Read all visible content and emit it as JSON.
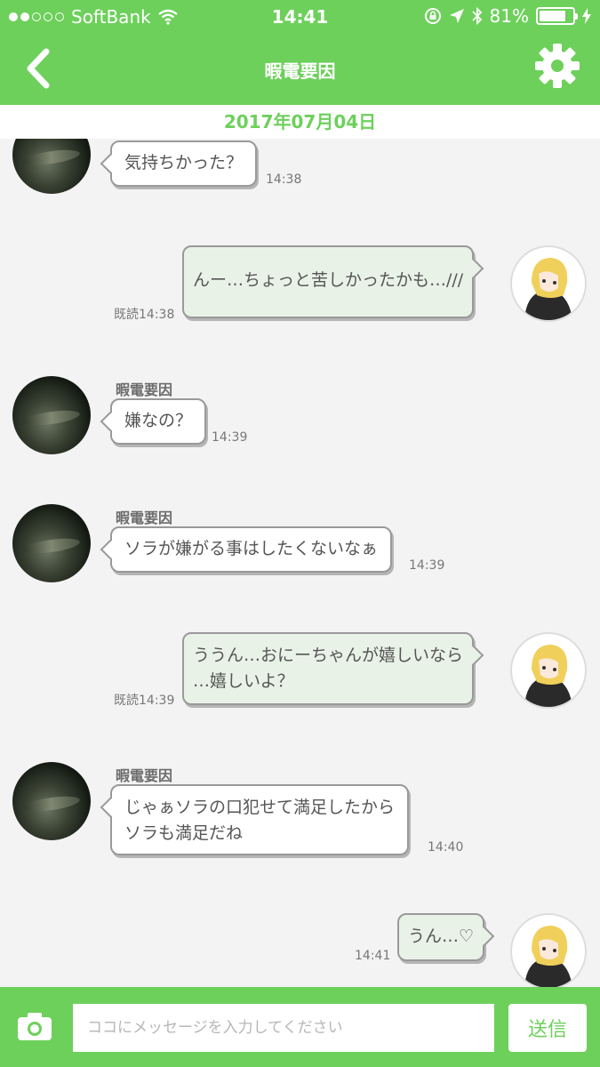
{
  "status_bar": {
    "carrier": "SoftBank",
    "time": "14:41",
    "battery_percent": "81%",
    "battery_level": 0.81,
    "signal_bars_filled": 2,
    "signal_bars_total": 5
  },
  "header": {
    "title": "暇電要因",
    "back_icon": "chevron-left-icon",
    "settings_icon": "gear-icon"
  },
  "date_label": "2017年07月04日",
  "messages": [
    {
      "side": "in",
      "sender": "",
      "lines": [
        "気持ちかった？"
      ],
      "time": "14:38",
      "read": ""
    },
    {
      "side": "out",
      "sender": "",
      "lines": [
        "んー…ちょっと苦しかったかも…///"
      ],
      "time": "14:38",
      "read": "既読"
    },
    {
      "side": "in",
      "sender": "暇電要因",
      "lines": [
        "嫌なの？"
      ],
      "time": "14:39",
      "read": ""
    },
    {
      "side": "in",
      "sender": "暇電要因",
      "lines": [
        "ソラが嫌がる事はしたくないなぁ"
      ],
      "time": "14:39",
      "read": ""
    },
    {
      "side": "out",
      "sender": "",
      "lines": [
        "ううん…おにーちゃんが嬉しいなら",
        "…嬉しいよ？"
      ],
      "time": "14:39",
      "read": "既読"
    },
    {
      "side": "in",
      "sender": "暇電要因",
      "lines": [
        "じゃぁソラの口犯せて満足したから",
        "ソラも満足だね"
      ],
      "time": "14:40",
      "read": ""
    },
    {
      "side": "out",
      "sender": "",
      "lines": [
        "うん…♡"
      ],
      "time": "14:41",
      "read": ""
    }
  ],
  "input_bar": {
    "placeholder": "ココにメッセージを入力してください",
    "value": "",
    "send_label": "送信",
    "camera_icon": "camera-icon"
  },
  "colors": {
    "brand_green": "#6dd05b",
    "outgoing_bubble": "#e9f2e7",
    "incoming_bubble": "#ffffff",
    "background": "#f3f3f3"
  }
}
